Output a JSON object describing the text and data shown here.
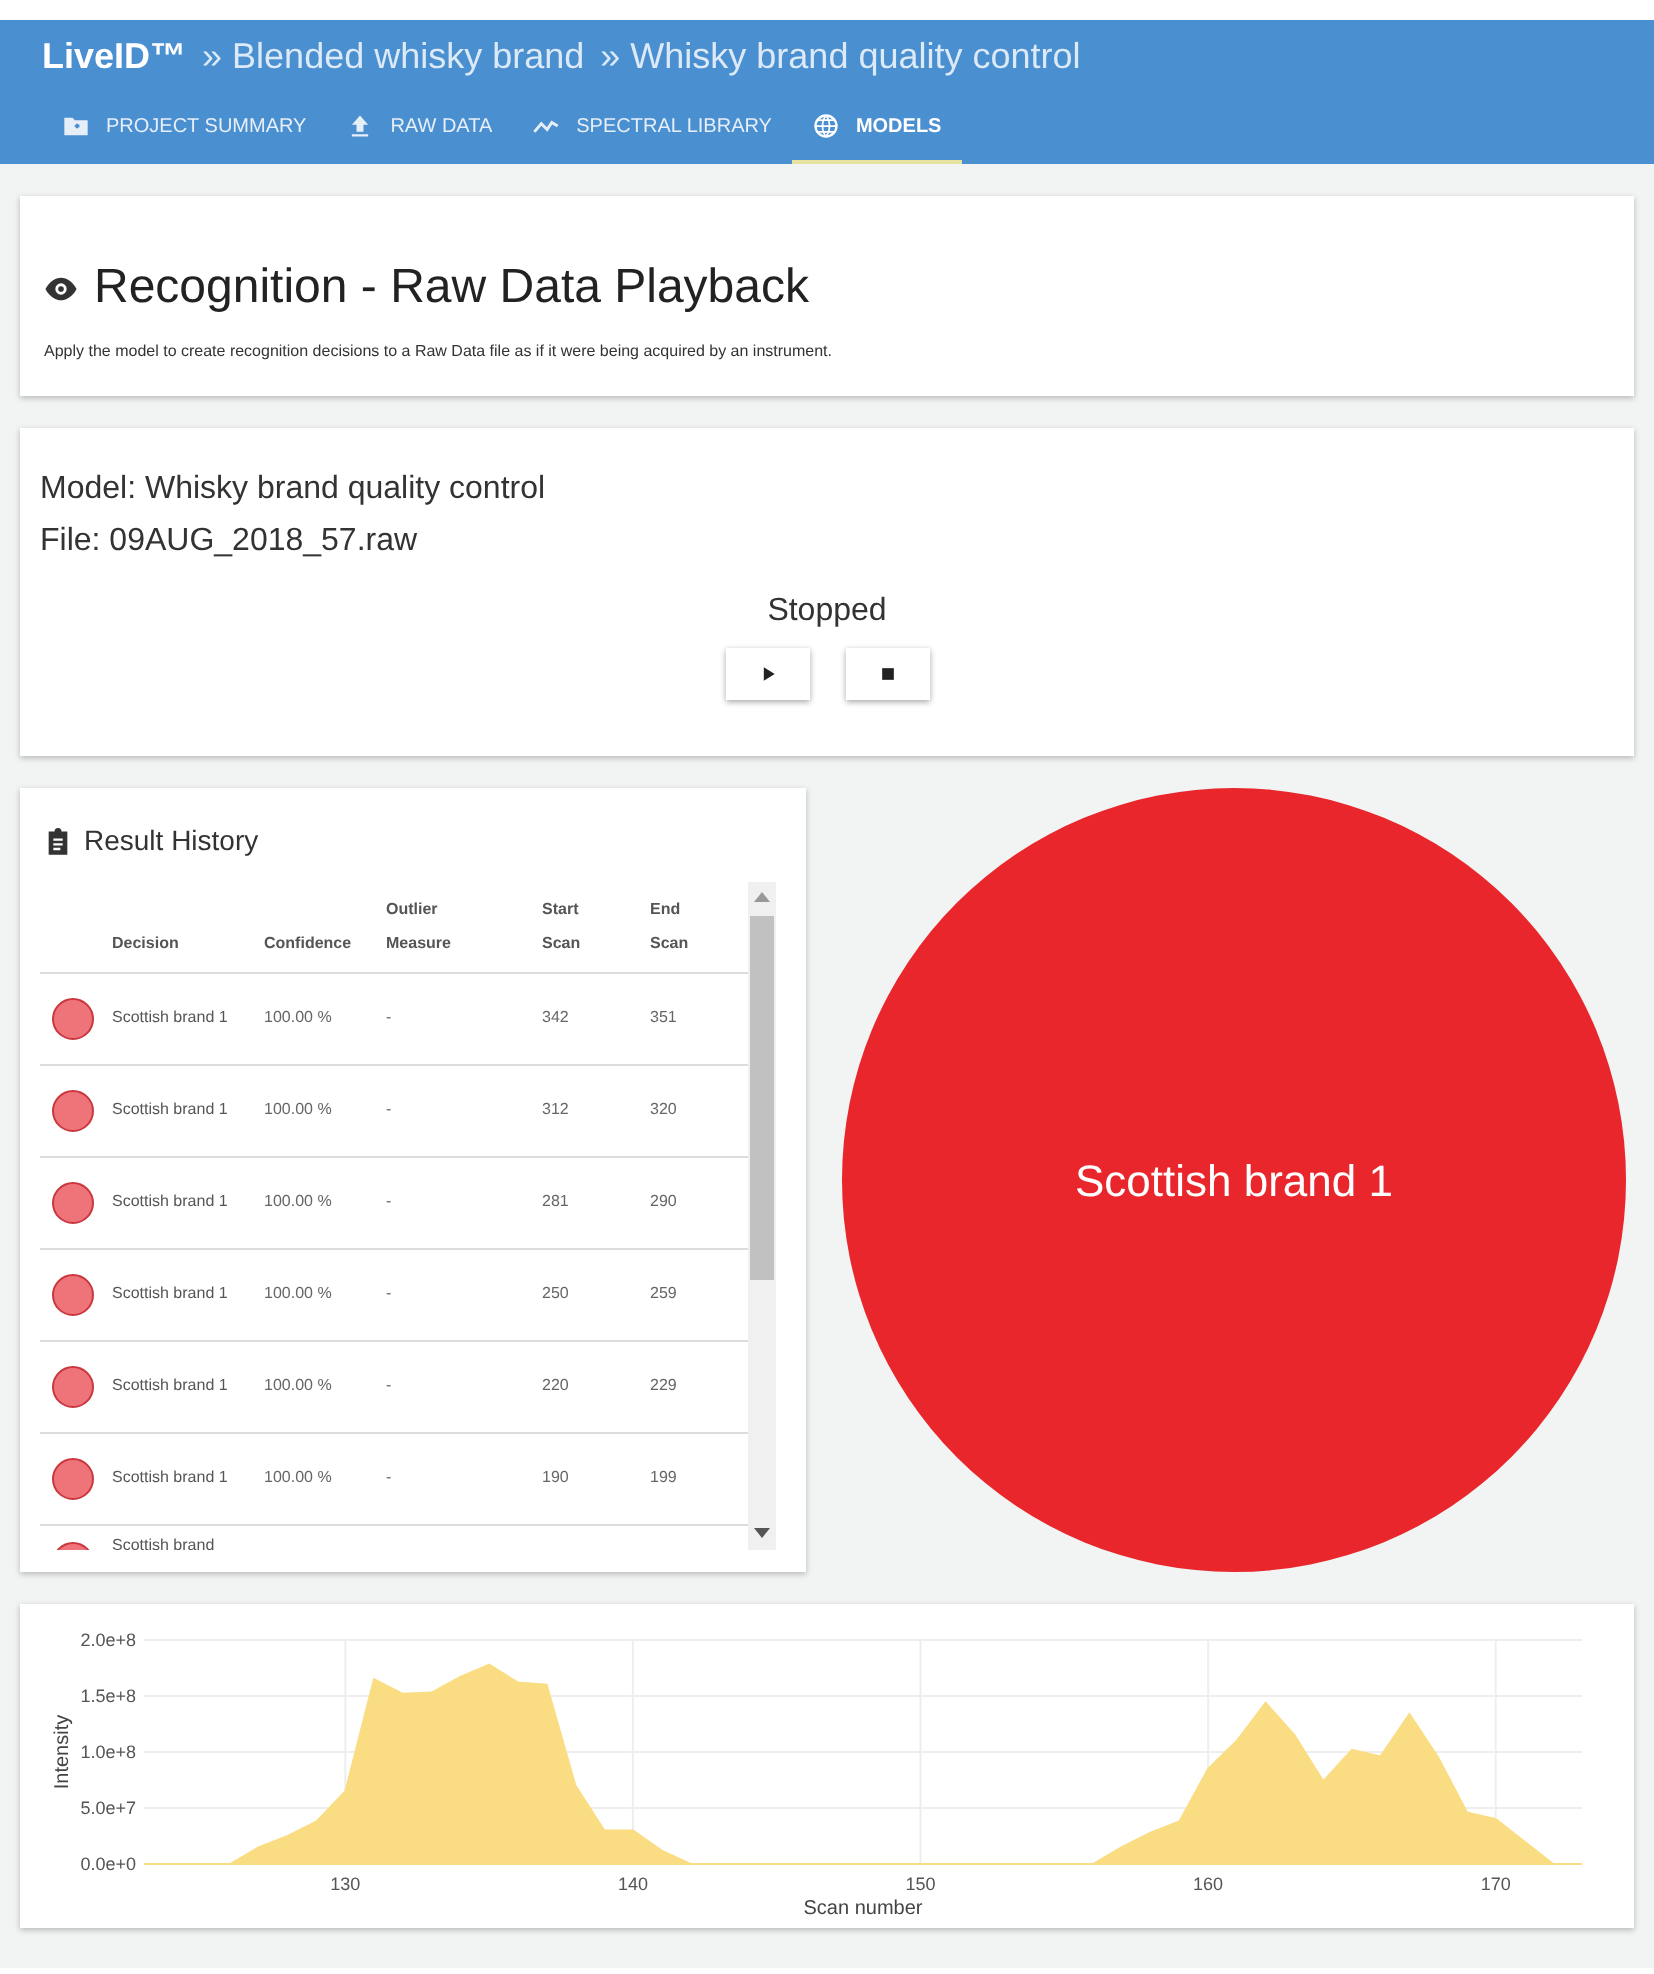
{
  "header": {
    "brand": "LiveID™",
    "breadcrumbs": [
      "» Blended whisky brand",
      "» Whisky brand quality control"
    ]
  },
  "tabs": [
    {
      "label": "PROJECT SUMMARY",
      "selected": false
    },
    {
      "label": "RAW DATA",
      "selected": false
    },
    {
      "label": "SPECTRAL LIBRARY",
      "selected": false
    },
    {
      "label": "MODELS",
      "selected": true
    }
  ],
  "page": {
    "title": "Recognition - Raw Data Playback",
    "description": "Apply the model to create recognition decisions to a Raw Data file as if it were being acquired by an instrument."
  },
  "playback": {
    "model": "Model: Whisky brand quality control",
    "file": "File: 09AUG_2018_57.raw",
    "status": "Stopped"
  },
  "result_history": {
    "title": "Result History",
    "columns": [
      "",
      "Decision",
      "Confidence",
      "Outlier Measure",
      "Start Scan",
      "End Scan"
    ],
    "rows": [
      {
        "decision": "Scottish brand 1",
        "confidence": "100.00 %",
        "outlier": "-",
        "start": "342",
        "end": "351"
      },
      {
        "decision": "Scottish brand 1",
        "confidence": "100.00 %",
        "outlier": "-",
        "start": "312",
        "end": "320"
      },
      {
        "decision": "Scottish brand 1",
        "confidence": "100.00 %",
        "outlier": "-",
        "start": "281",
        "end": "290"
      },
      {
        "decision": "Scottish brand 1",
        "confidence": "100.00 %",
        "outlier": "-",
        "start": "250",
        "end": "259"
      },
      {
        "decision": "Scottish brand 1",
        "confidence": "100.00 %",
        "outlier": "-",
        "start": "220",
        "end": "229"
      },
      {
        "decision": "Scottish brand 1",
        "confidence": "100.00 %",
        "outlier": "-",
        "start": "190",
        "end": "199"
      },
      {
        "decision": "Scottish brand"
      }
    ]
  },
  "current_decision": {
    "label": "Scottish brand 1",
    "color": "#e8262b"
  },
  "chart": {
    "chart_data": {
      "type": "area",
      "xlabel": "Scan number",
      "ylabel": "Intensity",
      "x": [
        123,
        124,
        125,
        126,
        127,
        128,
        129,
        130,
        131,
        132,
        133,
        134,
        135,
        136,
        137,
        138,
        139,
        140,
        141,
        142,
        143,
        144,
        145,
        146,
        147,
        148,
        149,
        150,
        151,
        152,
        153,
        154,
        155,
        156,
        157,
        158,
        159,
        160,
        161,
        162,
        163,
        164,
        165,
        166,
        167,
        168,
        169,
        170,
        171,
        172,
        173
      ],
      "grid": true,
      "series": [
        {
          "color": "#fadd82",
          "values": [
            0,
            0,
            0,
            0,
            15000000,
            25000000,
            38000000,
            65000000,
            165000000,
            152000000,
            153000000,
            167000000,
            178000000,
            162000000,
            160000000,
            70000000,
            30000000,
            30000000,
            12000000,
            0,
            0,
            0,
            0,
            0,
            0,
            0,
            0,
            0,
            0,
            0,
            0,
            0,
            0,
            0,
            15000000,
            28000000,
            38000000,
            85000000,
            110000000,
            144000000,
            115000000,
            74000000,
            102000000,
            96000000,
            134000000,
            95000000,
            46000000,
            40000000,
            20000000,
            0,
            0
          ]
        }
      ],
      "xlim": [
        123,
        173
      ],
      "ylim": [
        0,
        200000000
      ],
      "xticks": [
        130,
        140,
        150,
        160,
        170
      ],
      "yticks": [
        {
          "value": 0,
          "label": "0.0e+0"
        },
        {
          "value": 50000000,
          "label": "5.0e+7"
        },
        {
          "value": 100000000,
          "label": "1.0e+8"
        },
        {
          "value": 150000000,
          "label": "1.5e+8"
        },
        {
          "value": 200000000,
          "label": "2.0e+8"
        }
      ]
    }
  }
}
